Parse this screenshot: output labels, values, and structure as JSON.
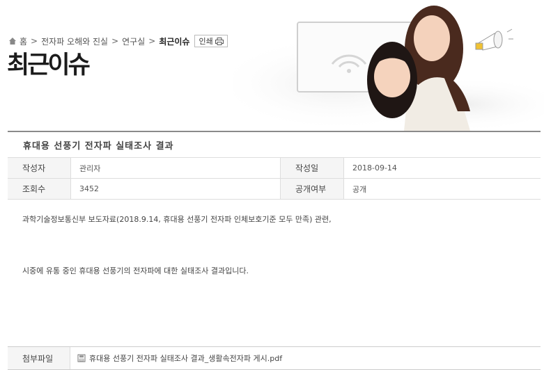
{
  "breadcrumb": {
    "items": [
      "홈",
      "전자파 오해와 진실",
      "연구실"
    ],
    "current": "최근이슈",
    "print_label": "인쇄"
  },
  "page_title": "최근이슈",
  "article": {
    "title": "휴대용 선풍기 전자파 실태조사 결과",
    "meta": {
      "author_label": "작성자",
      "author_value": "관리자",
      "date_label": "작성일",
      "date_value": "2018-09-14",
      "views_label": "조회수",
      "views_value": "3452",
      "public_label": "공개여부",
      "public_value": "공개"
    },
    "body": [
      "과학기술정보통신부 보도자료(2018.9.14, 휴대용 선풍기 전자파 인체보호기준 모두 만족) 관련,",
      "시중에 유통 중인 휴대용 선풍기의 전자파에 대한 실태조사 결과입니다."
    ],
    "attachment": {
      "label": "첨부파일",
      "filename": "휴대용 선풍기 전자파 실태조사 결과_생활속전자파 게시.pdf"
    }
  }
}
